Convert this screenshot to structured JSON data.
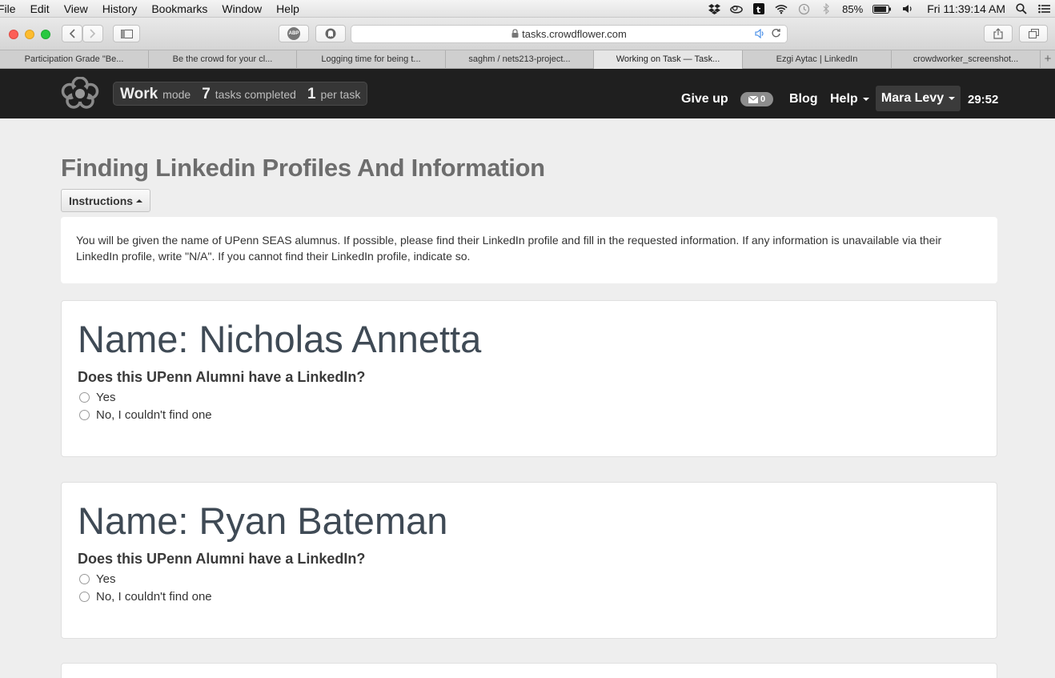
{
  "menubar": {
    "items": [
      "File",
      "Edit",
      "View",
      "History",
      "Bookmarks",
      "Window",
      "Help"
    ],
    "battery": "85%",
    "clock": "Fri 11:39:14 AM"
  },
  "toolbar": {
    "url": "tasks.crowdflower.com",
    "adblock_label": "ABP"
  },
  "tabs": [
    "Participation Grade \"Be...",
    "Be the crowd for your cl...",
    "Logging time for being t...",
    "saghm / nets213-project...",
    "Working on Task — Task...",
    "Ezgi Aytac | LinkedIn",
    "crowdworker_screenshot..."
  ],
  "appbar": {
    "work_label": "Work",
    "mode_label": "mode",
    "tasks_count": "7",
    "tasks_label": "tasks completed",
    "per_task_count": "1",
    "per_task_label": "per task",
    "give_up": "Give up",
    "mail_count": "0",
    "blog": "Blog",
    "help": "Help",
    "user": "Mara Levy",
    "timer": "29:52"
  },
  "page": {
    "title": "Finding Linkedin Profiles And Information",
    "instructions_button": "Instructions",
    "instructions_text": "You will be given the name of UPenn SEAS alumnus. If possible, please find their LinkedIn profile and fill in the requested information. If any information is unavailable via their LinkedIn profile, write \"N/A\". If you cannot find their LinkedIn profile, indicate so."
  },
  "cards": [
    {
      "name": "Name: Nicholas Annetta",
      "question": "Does this UPenn Alumni have a LinkedIn?",
      "option_yes": "Yes",
      "option_no": "No, I couldn't find one"
    },
    {
      "name": "Name: Ryan Bateman",
      "question": "Does this UPenn Alumni have a LinkedIn?",
      "option_yes": "Yes",
      "option_no": "No, I couldn't find one"
    }
  ],
  "colors": {
    "appbar_bg": "#1f1f1f",
    "page_bg": "#eeeeee",
    "name_color": "#3f4a55"
  }
}
